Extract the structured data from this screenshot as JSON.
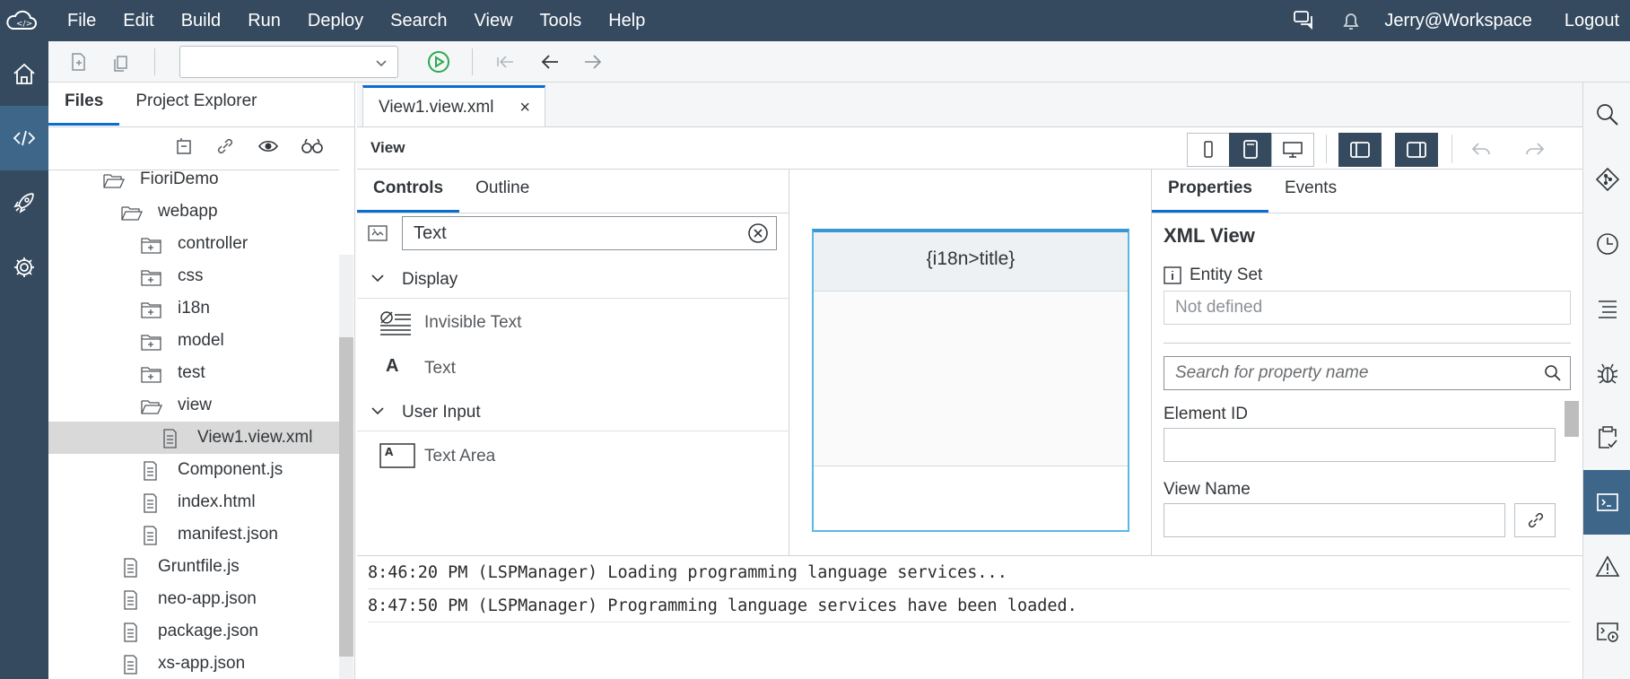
{
  "menubar": {
    "items": [
      "File",
      "Edit",
      "Build",
      "Run",
      "Deploy",
      "Search",
      "View",
      "Tools",
      "Help"
    ],
    "user": "Jerry@Workspace",
    "logout": "Logout",
    "icons": [
      "cloud-logo-icon",
      "chat-icon",
      "bell-icon"
    ]
  },
  "leftbar": {
    "items": [
      "home-icon",
      "code-icon",
      "rocket-icon",
      "gear-icon"
    ],
    "active": "code-icon"
  },
  "toolbar": {
    "run_config_value": "",
    "icons": [
      "new-file-icon",
      "copy-icon",
      "run-icon",
      "back-to-edit-icon",
      "navigate-back-icon",
      "navigate-forward-icon"
    ]
  },
  "filepanel": {
    "tabs": [
      "Files",
      "Project Explorer"
    ],
    "selected_tab": "Files",
    "action_icons": [
      "collapse-all-icon",
      "link-icon",
      "show-hidden-icon",
      "search-icon"
    ],
    "tree": [
      {
        "label": "FioriDemo",
        "type": "folder-open"
      },
      {
        "label": "webapp",
        "type": "folder-open"
      },
      {
        "label": "controller",
        "type": "folder"
      },
      {
        "label": "css",
        "type": "folder"
      },
      {
        "label": "i18n",
        "type": "folder"
      },
      {
        "label": "model",
        "type": "folder"
      },
      {
        "label": "test",
        "type": "folder"
      },
      {
        "label": "view",
        "type": "folder-open"
      },
      {
        "label": "View1.view.xml",
        "type": "file",
        "selected": true
      },
      {
        "label": "Component.js",
        "type": "file"
      },
      {
        "label": "index.html",
        "type": "file"
      },
      {
        "label": "manifest.json",
        "type": "file"
      },
      {
        "label": "Gruntfile.js",
        "type": "file"
      },
      {
        "label": "neo-app.json",
        "type": "file"
      },
      {
        "label": "package.json",
        "type": "file"
      },
      {
        "label": "xs-app.json",
        "type": "file"
      }
    ]
  },
  "editor": {
    "tab": "View1.view.xml",
    "tab_close": "×",
    "view_header": "View",
    "device_buttons": [
      "phone-icon",
      "tablet-icon",
      "desktop-icon"
    ],
    "active_device": "tablet-icon",
    "pane_toggles": [
      "left-pane-icon",
      "right-pane-icon"
    ],
    "history_icons": [
      "undo-icon",
      "redo-icon"
    ]
  },
  "controls": {
    "tabs": [
      "Controls",
      "Outline"
    ],
    "selected_tab": "Controls",
    "search_value": "Text",
    "groups": [
      {
        "label": "Display",
        "items": [
          {
            "label": "Invisible Text",
            "icon": "invisible-text-icon"
          },
          {
            "label": "Text",
            "icon": "text-a-icon"
          }
        ]
      },
      {
        "label": "User Input",
        "items": [
          {
            "label": "Text Area",
            "icon": "text-area-icon"
          }
        ]
      }
    ]
  },
  "canvas": {
    "page_title": "{i18n>title}"
  },
  "properties": {
    "tabs": [
      "Properties",
      "Events"
    ],
    "selected_tab": "Properties",
    "title": "XML View",
    "entity_set_label": "Entity Set",
    "entity_set_value": "Not defined",
    "search_placeholder": "Search for property name",
    "element_id_label": "Element ID",
    "element_id_value": "",
    "view_name_label": "View Name",
    "view_name_value": ""
  },
  "console": {
    "lines": [
      "8:46:20 PM (LSPManager) Loading programming language services...",
      "8:47:50 PM (LSPManager) Programming language services have been loaded."
    ]
  },
  "rightbar": {
    "items": [
      "search-icon",
      "git-icon",
      "history-icon",
      "outline-icon",
      "debug-icon",
      "clipboard-check-icon",
      "console-icon",
      "warning-icon",
      "run-console-icon"
    ],
    "active": "console-icon"
  },
  "colors": {
    "shell": "#354a5f",
    "active": "#3e6689",
    "accent": "#0a6ed1",
    "run_green": "#2fa84f"
  }
}
